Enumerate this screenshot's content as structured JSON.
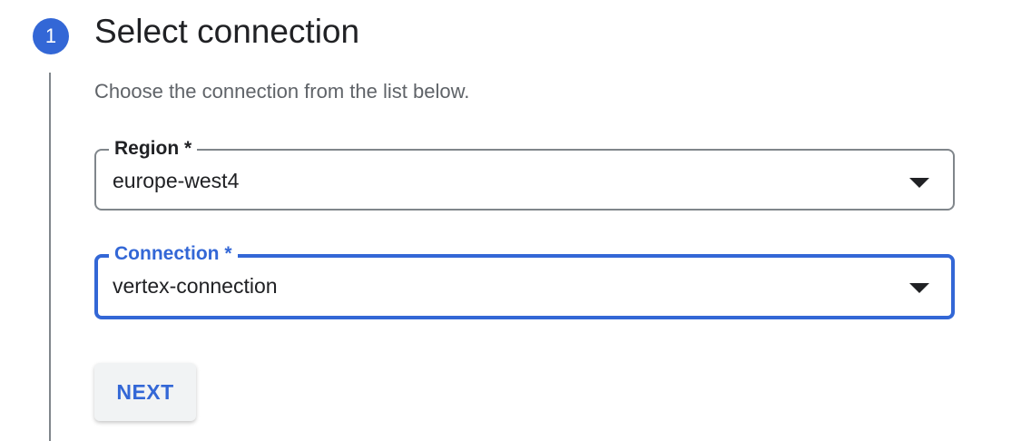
{
  "step": {
    "number": "1",
    "title": "Select connection",
    "description": "Choose the connection from the list below."
  },
  "fields": {
    "region": {
      "label": "Region *",
      "value": "europe-west4"
    },
    "connection": {
      "label": "Connection *",
      "value": "vertex-connection"
    }
  },
  "actions": {
    "next_label": "NEXT"
  },
  "colors": {
    "accent": "#3367d6",
    "text": "#202124",
    "muted_text": "#5f6368",
    "outline": "#80868b",
    "button_bg": "#f1f3f4"
  },
  "icons": {
    "select_arrow": "arrow-drop-down-icon"
  }
}
